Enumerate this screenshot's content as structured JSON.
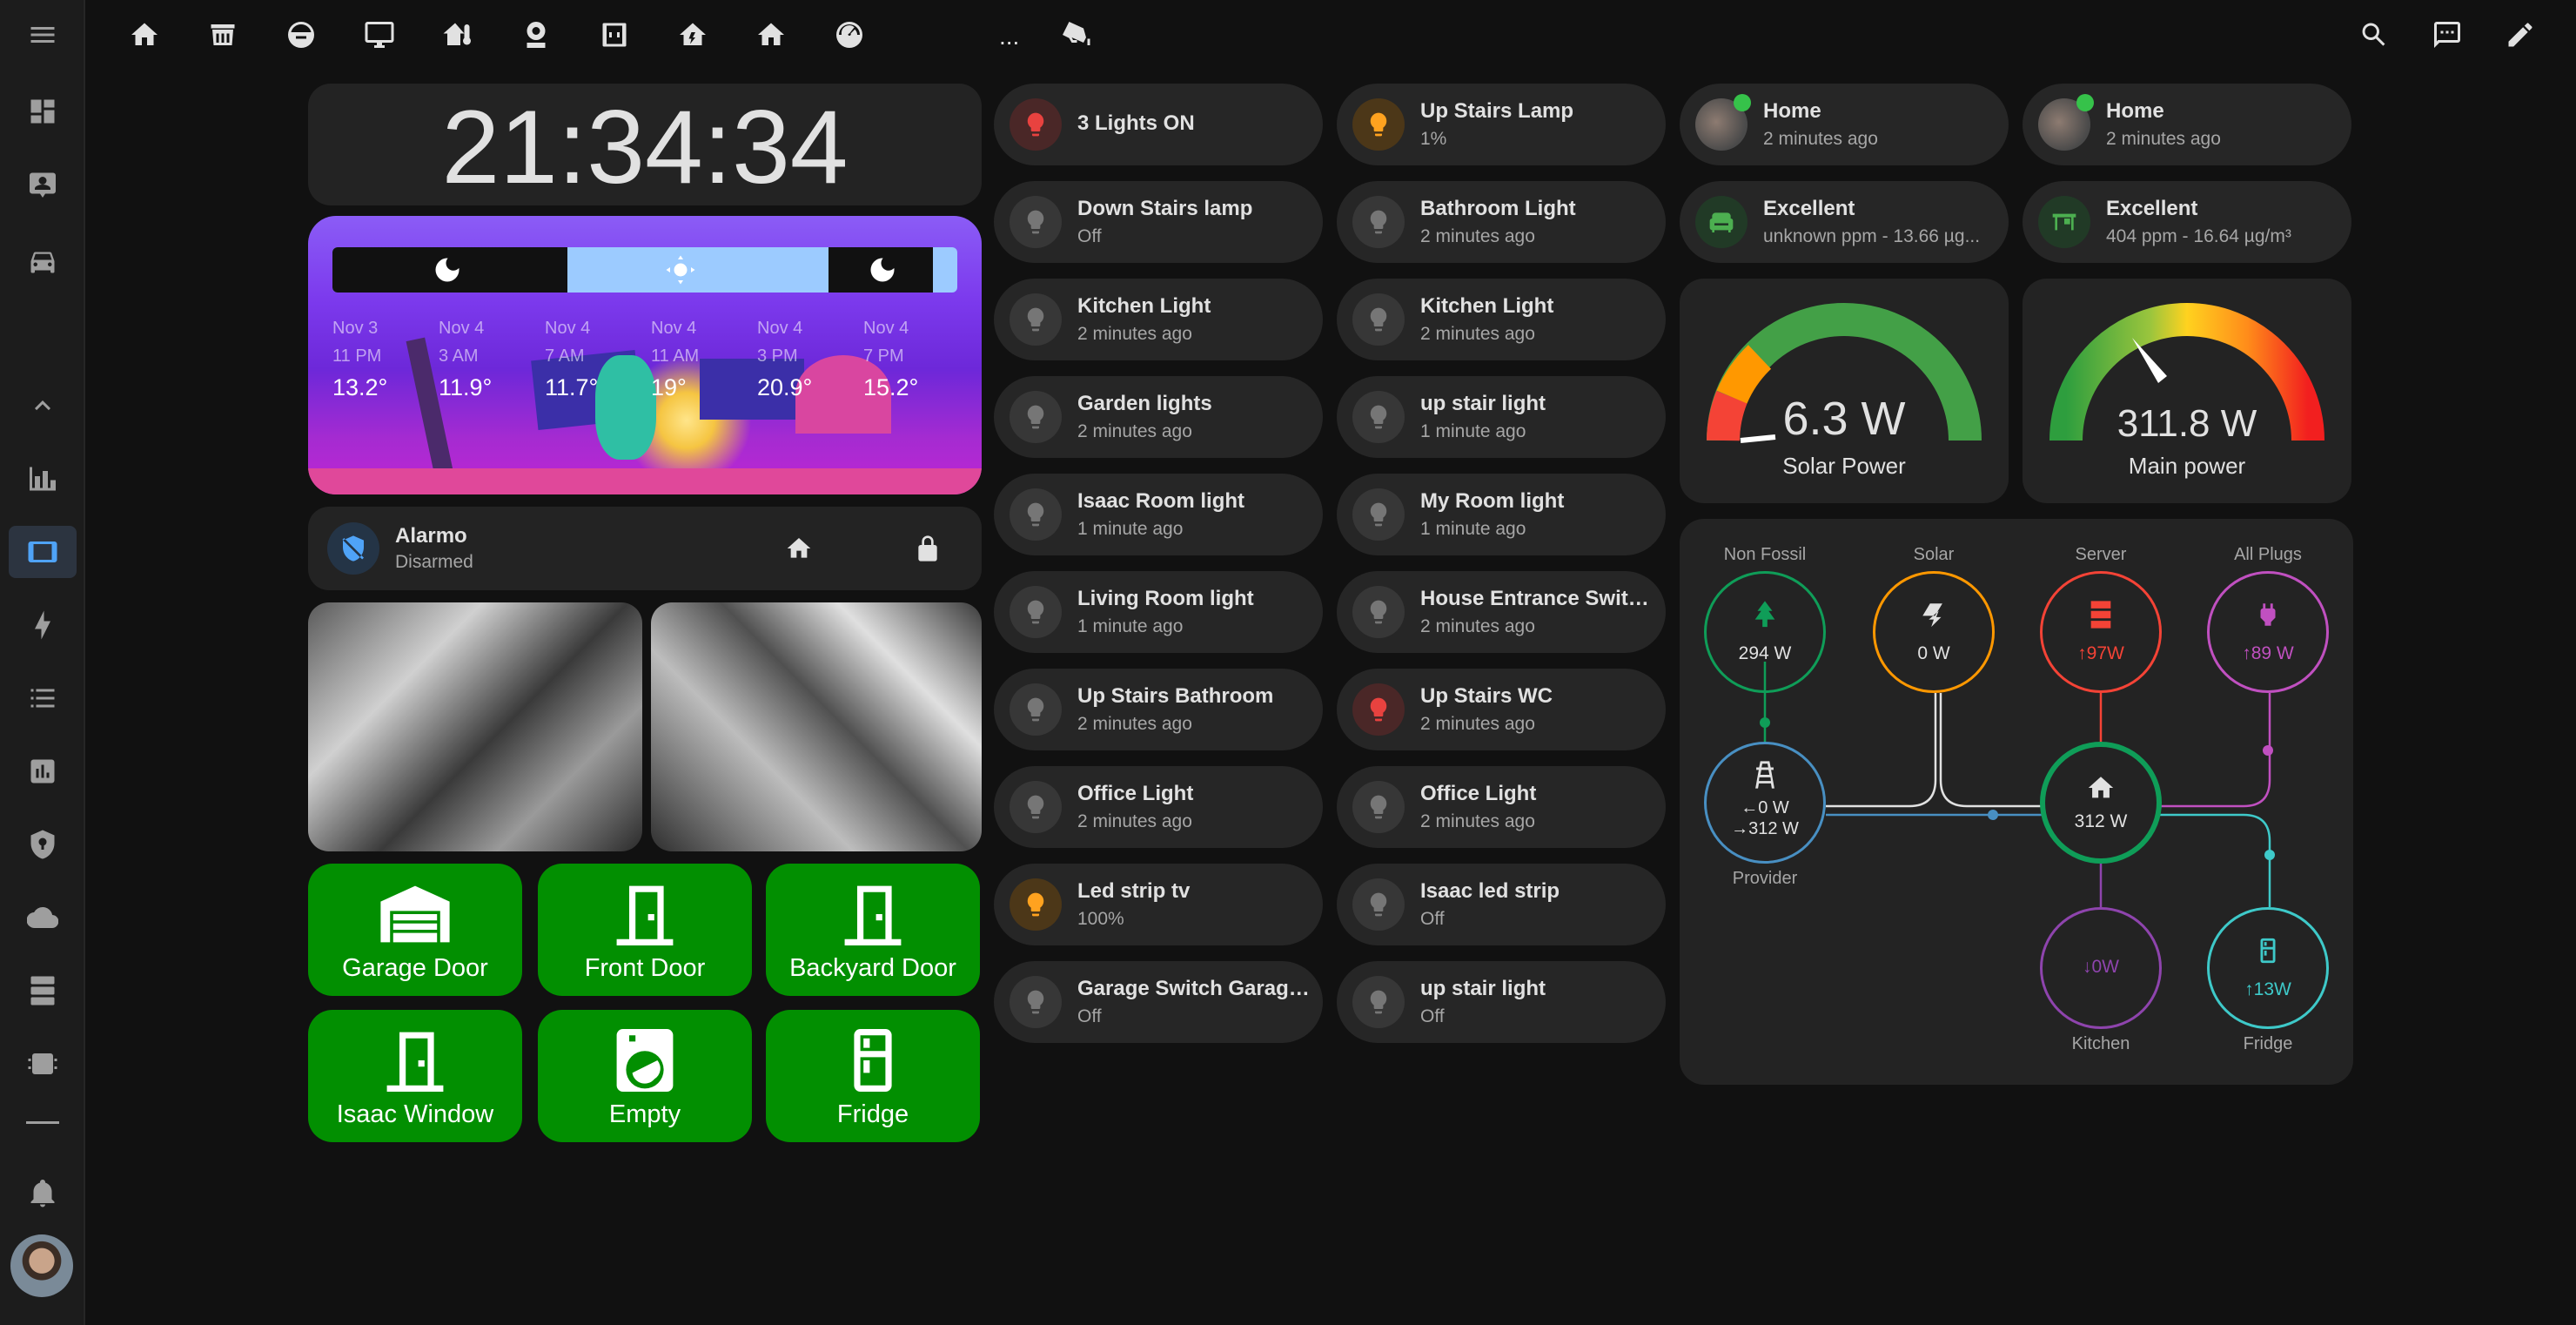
{
  "topbar": {
    "more": "...",
    "icons": [
      "home-icon",
      "store-icon",
      "robot-vacuum-icon",
      "monitor-icon",
      "home-thermometer-icon",
      "webcam-icon",
      "smart-socket-icon",
      "home-lightning-icon",
      "home-icon",
      "speedometer-icon",
      "cctv-icon"
    ],
    "right_icons": [
      "search-icon",
      "assist-icon",
      "pencil-icon"
    ]
  },
  "sidebar": {
    "items": [
      "dashboard-icon",
      "contact-card-icon",
      "car-icon",
      "chevron-up-icon",
      "energy-chart-icon",
      "tablet-icon",
      "lightning-icon",
      "list-icon",
      "history-chart-icon",
      "shield-icon",
      "cloud-icon",
      "server-icon",
      "chip-icon",
      "notifications-bell-icon"
    ]
  },
  "clock": {
    "time": "21:34:34"
  },
  "weather": {
    "forecast": [
      {
        "day": "Nov 3",
        "time": "11 PM",
        "temp": "13.2°"
      },
      {
        "day": "Nov 4",
        "time": "3 AM",
        "temp": "11.9°"
      },
      {
        "day": "Nov 4",
        "time": "7 AM",
        "temp": "11.7°"
      },
      {
        "day": "Nov 4",
        "time": "11 AM",
        "temp": "19°"
      },
      {
        "day": "Nov 4",
        "time": "3 PM",
        "temp": "20.9°"
      },
      {
        "day": "Nov 4",
        "time": "7 PM",
        "temp": "15.2°"
      }
    ]
  },
  "alarm": {
    "name": "Alarmo",
    "state": "Disarmed"
  },
  "doors": [
    {
      "label": "Garage Door",
      "icon": "garage-icon"
    },
    {
      "label": "Front Door",
      "icon": "door-icon"
    },
    {
      "label": "Backyard Door",
      "icon": "door-icon"
    },
    {
      "label": "Isaac Window",
      "icon": "door-icon"
    },
    {
      "label": "Empty",
      "icon": "washing-machine-icon"
    },
    {
      "label": "Fridge",
      "icon": "fridge-icon"
    }
  ],
  "lights_col1": [
    {
      "name": "3 Lights ON",
      "state": "",
      "color": "red"
    },
    {
      "name": "Down Stairs lamp",
      "state": "Off"
    },
    {
      "name": "Kitchen Light",
      "state": "2 minutes ago"
    },
    {
      "name": "Garden lights",
      "state": "2 minutes ago"
    },
    {
      "name": "Isaac Room light",
      "state": "1 minute ago"
    },
    {
      "name": "Living Room light",
      "state": "1 minute ago"
    },
    {
      "name": "Up Stairs Bathroom",
      "state": "2 minutes ago"
    },
    {
      "name": "Office Light",
      "state": "2 minutes ago"
    },
    {
      "name": "Led strip tv",
      "state": "100%",
      "color": "amber"
    },
    {
      "name": "Garage Switch Garage...",
      "state": "Off"
    }
  ],
  "lights_col2": [
    {
      "name": "Up Stairs Lamp",
      "state": "1%",
      "color": "amber"
    },
    {
      "name": "Bathroom Light",
      "state": "2 minutes ago"
    },
    {
      "name": "Kitchen Light",
      "state": "2 minutes ago"
    },
    {
      "name": "up stair light",
      "state": "1 minute ago"
    },
    {
      "name": "My Room light",
      "state": "1 minute ago"
    },
    {
      "name": "House Entrance Switc...",
      "state": "2 minutes ago"
    },
    {
      "name": "Up Stairs WC",
      "state": "2 minutes ago",
      "color": "red"
    },
    {
      "name": "Office Light",
      "state": "2 minutes ago"
    },
    {
      "name": "Isaac led strip",
      "state": "Off"
    },
    {
      "name": "up stair light",
      "state": "Off"
    }
  ],
  "presence": [
    {
      "name": "Home",
      "state": "2 minutes ago"
    },
    {
      "name": "Home",
      "state": "2 minutes ago"
    }
  ],
  "air": [
    {
      "name": "Excellent",
      "state": "unknown ppm - 13.66 µg..."
    },
    {
      "name": "Excellent",
      "state": "404 ppm - 16.64 µg/m³"
    }
  ],
  "gauges": [
    {
      "value": "6.3 W",
      "label": "Solar Power",
      "level": 1.0
    },
    {
      "value": "311.8 W",
      "label": "Main power",
      "level": 0.31
    }
  ],
  "energy": {
    "non_fossil": {
      "label": "Non Fossil",
      "value": "294 W"
    },
    "solar": {
      "label": "Solar",
      "value": "0 W"
    },
    "server": {
      "label": "Server",
      "value": "↑97W"
    },
    "plugs": {
      "label": "All Plugs",
      "value": "↑89 W"
    },
    "grid": {
      "label": "Provider",
      "in": "←0 W",
      "out": "→312 W"
    },
    "home": {
      "value": "312 W"
    },
    "kitchen": {
      "label": "Kitchen",
      "value": "↓0W"
    },
    "fridge": {
      "label": "Fridge",
      "value": "↑13W"
    },
    "colors": {
      "non_fossil": "#0f9d58",
      "solar": "#ff9800",
      "server": "#f44336",
      "plugs": "#c050c0",
      "grid": "#488fc2",
      "home": "#0f9d58",
      "kitchen": "#8e44ad",
      "fridge": "#3ec9c9"
    }
  }
}
